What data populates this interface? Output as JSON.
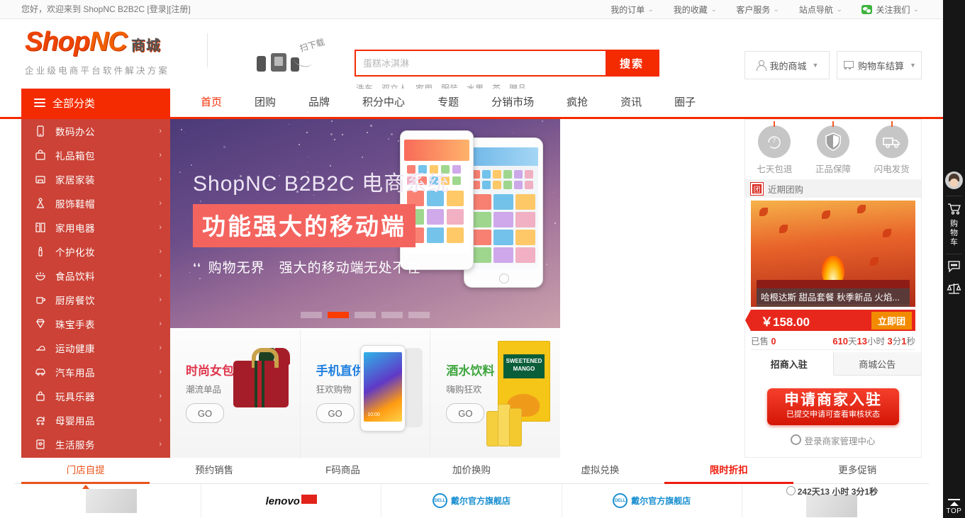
{
  "topbar": {
    "greeting": "您好，欢迎来到 ShopNC B2B2C",
    "login": "[登录]",
    "register": "[注册]",
    "menus": [
      {
        "label": "我的订单"
      },
      {
        "label": "我的收藏"
      },
      {
        "label": "客户服务"
      },
      {
        "label": "站点导航"
      }
    ],
    "wechat": "关注我们"
  },
  "header": {
    "logo_main": "Shop",
    "logo_accent": "NC",
    "logo_cn": "商城",
    "logo_sub": "企业级电商平台软件解决方案",
    "scan_text": "扫下载",
    "search": {
      "placeholder": "蛋糕冰淇淋",
      "value": "",
      "button": "搜索",
      "hot_keywords": [
        "洗车",
        "双立人",
        "家用",
        "服装",
        "水果",
        "茶",
        "赠品"
      ]
    },
    "my_store": "我的商城",
    "cart_checkout": "购物车结算"
  },
  "nav": {
    "all_categories": "全部分类",
    "links": [
      {
        "label": "首页",
        "active": true
      },
      {
        "label": "团购",
        "active": false
      },
      {
        "label": "品牌",
        "active": false
      },
      {
        "label": "积分中心",
        "active": false
      },
      {
        "label": "专题",
        "active": false
      },
      {
        "label": "分销市场",
        "active": false
      },
      {
        "label": "疯抢",
        "active": false
      },
      {
        "label": "资讯",
        "active": false
      },
      {
        "label": "圈子",
        "active": false
      }
    ]
  },
  "categories": [
    {
      "label": "数码办公",
      "icon": "phone-icon"
    },
    {
      "label": "礼品箱包",
      "icon": "bag-icon"
    },
    {
      "label": "家居家装",
      "icon": "home-icon"
    },
    {
      "label": "服饰鞋帽",
      "icon": "dress-icon"
    },
    {
      "label": "家用电器",
      "icon": "fridge-icon"
    },
    {
      "label": "个护化妆",
      "icon": "lipstick-icon"
    },
    {
      "label": "食品饮料",
      "icon": "bowl-icon"
    },
    {
      "label": "厨房餐饮",
      "icon": "cup-icon"
    },
    {
      "label": "珠宝手表",
      "icon": "diamond-icon"
    },
    {
      "label": "运动健康",
      "icon": "shoe-icon"
    },
    {
      "label": "汽车用品",
      "icon": "car-icon"
    },
    {
      "label": "玩具乐器",
      "icon": "toy-icon"
    },
    {
      "label": "母婴用品",
      "icon": "stroller-icon"
    },
    {
      "label": "生活服务",
      "icon": "service-icon"
    }
  ],
  "slider": {
    "line1": "ShopNC B2B2C 电商系统",
    "line2": "功能强大的移动端",
    "line3": "购物无界　强大的移动端无处不在",
    "quote_open": "❛❛",
    "quote_close": "❜❜",
    "dots": 5,
    "active_dot": 2
  },
  "promos": [
    {
      "title": "时尚女包",
      "subtitle": "潮流单品",
      "go": "GO",
      "color": "#e0364c"
    },
    {
      "title": "手机直供",
      "subtitle": "狂欢购物",
      "go": "GO",
      "color": "#1f7fe0"
    },
    {
      "title": "酒水饮料",
      "subtitle": "嗨购狂欢",
      "go": "GO",
      "color": "#3fa63f"
    }
  ],
  "right_panel": {
    "services": [
      {
        "label": "七天包退",
        "icon": "seven-day-return-icon"
      },
      {
        "label": "正品保障",
        "icon": "shield-icon"
      },
      {
        "label": "闪电发货",
        "icon": "truck-icon"
      }
    ],
    "group_header": "近期团购",
    "group_badge": "团",
    "group_item_name": "哈根达斯 甜品套餐 秋季新品 火焰...",
    "price": "￥158.00",
    "buy_button": "立即团",
    "sold_label": "已售",
    "sold_count": "0",
    "countdown": {
      "days": "610",
      "days_unit": "天",
      "hours": "13",
      "hours_unit": "小时",
      "minutes": "3",
      "minutes_unit": "分",
      "seconds": "1",
      "seconds_unit": "秒"
    },
    "tabs": [
      {
        "label": "招商入驻",
        "active": true
      },
      {
        "label": "商城公告",
        "active": false
      }
    ],
    "join_title": "申请商家入驻",
    "join_sub": "已提交申请可查看审核状态",
    "join_link": "登录商家管理中心"
  },
  "bottom": {
    "tabs": [
      {
        "label": "门店自提",
        "state": "on"
      },
      {
        "label": "预约销售",
        "state": ""
      },
      {
        "label": "F码商品",
        "state": ""
      },
      {
        "label": "加价换购",
        "state": ""
      },
      {
        "label": "虚拟兑换",
        "state": ""
      },
      {
        "label": "限时折扣",
        "state": "hot"
      },
      {
        "label": "更多促销",
        "state": ""
      }
    ],
    "cards": [
      {
        "brand": ""
      },
      {
        "brand": "lenovo"
      },
      {
        "brand": "戴尔官方旗舰店"
      },
      {
        "brand": "戴尔官方旗舰店"
      },
      {
        "brand": ""
      }
    ],
    "countdown": "242天13 小时 3分1秒"
  },
  "rail": {
    "cart_label": "购物车",
    "top_label": "TOP",
    "items": [
      {
        "name": "avatar"
      },
      {
        "name": "cart"
      },
      {
        "name": "chat"
      },
      {
        "name": "compare"
      }
    ]
  },
  "colors": {
    "primary_red": "#f42b00",
    "cat_red": "#c9372a",
    "orange": "#e8541b",
    "hot_red": "#ee1c0e"
  }
}
